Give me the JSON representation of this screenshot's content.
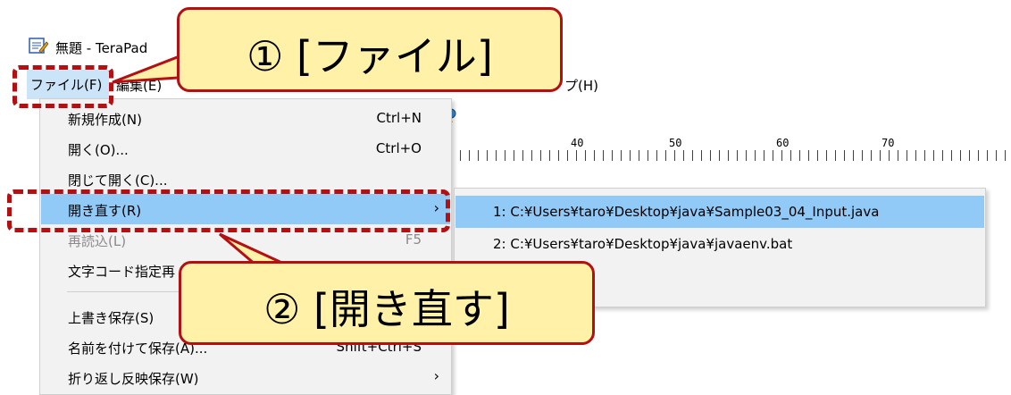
{
  "window": {
    "title": "無題 - TeraPad",
    "icon": "notepad-icon"
  },
  "menu_bar": [
    {
      "label": "ファイル(F)"
    },
    {
      "label": "編集(E)"
    },
    {
      "label": "プ(H)"
    }
  ],
  "toolbar": {
    "icon": "balloon-icon"
  },
  "ruler": {
    "labels": [
      "40",
      "50",
      "60",
      "70"
    ]
  },
  "file_menu": {
    "items": [
      {
        "label": "新規作成(N)",
        "shortcut": "Ctrl+N"
      },
      {
        "label": "開く(O)...",
        "shortcut": "Ctrl+O"
      },
      {
        "label": "閉じて開く(C)...",
        "shortcut": ""
      },
      {
        "label": "開き直す(R)",
        "shortcut": "",
        "submenu_arrow": "›"
      },
      {
        "label": "再読込(L)",
        "shortcut": "F5"
      },
      {
        "label": "文字コード指定再",
        "shortcut": ""
      },
      {
        "label": "上書き保存(S)",
        "shortcut": ""
      },
      {
        "label": "名前を付けて保存(A)...",
        "shortcut": "Shift+Ctrl+S"
      },
      {
        "label": "折り返し反映保存(W)",
        "shortcut": "",
        "submenu_arrow": "›"
      }
    ]
  },
  "reopen_submenu": {
    "items": [
      {
        "label": "1: C:¥Users¥taro¥Desktop¥java¥Sample03_04_Input.java"
      },
      {
        "label": "2: C:¥Users¥taro¥Desktop¥java¥javaenv.bat"
      }
    ]
  },
  "annotations": {
    "callout_1": "① [ファイル]",
    "callout_2": "② [開き直す]",
    "highlight_color": "#b40f12",
    "callout_fill": "#fff2a8"
  },
  "colors": {
    "menu_highlight": "#91c9f7",
    "menu_background": "#f2f2f2"
  }
}
